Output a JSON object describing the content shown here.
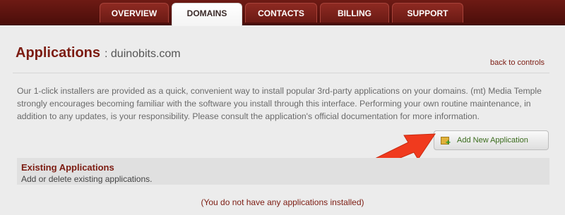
{
  "nav": {
    "tabs": [
      {
        "label": "OVERVIEW",
        "active": false
      },
      {
        "label": "DOMAINS",
        "active": true
      },
      {
        "label": "CONTACTS",
        "active": false
      },
      {
        "label": "BILLING",
        "active": false
      },
      {
        "label": "SUPPORT",
        "active": false
      }
    ]
  },
  "header": {
    "title": "Applications",
    "domain": ": duinobits.com",
    "back_link": "back to controls"
  },
  "main": {
    "description": "Our 1-click installers are provided as a quick, convenient way to install popular 3rd-party applications on your domains. (mt) Media Temple strongly encourages becoming familiar with the software you install through this interface. Performing your own routine maintenance, in addition to any updates, is your responsibility. Please consult the application's official documentation for more information.",
    "add_button_label": "Add New Application",
    "add_button_icon": "package-add-icon",
    "existing": {
      "title": "Existing Applications",
      "subtitle": "Add or delete existing applications."
    },
    "empty_message": "(You do not have any applications installed)"
  },
  "colors": {
    "accent": "#7c1c12",
    "nav_bg": "#5a120d",
    "arrow": "#f03a1e",
    "button_text": "#3c6d1e"
  }
}
